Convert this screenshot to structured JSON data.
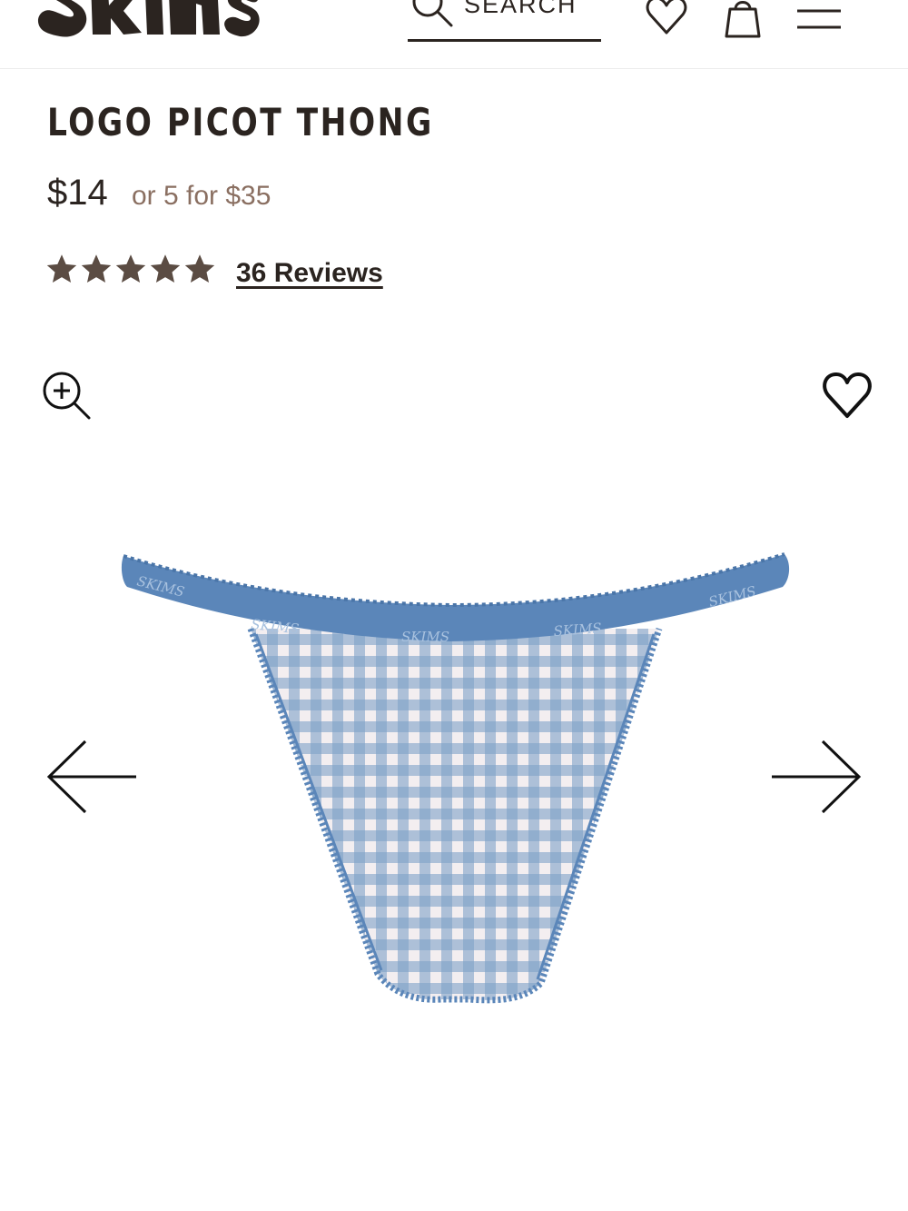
{
  "header": {
    "logo_text": "SKIMS",
    "search_label": "SEARCH",
    "icons": [
      "search-icon",
      "heart-icon",
      "bag-icon",
      "menu-icon"
    ]
  },
  "product": {
    "title": "LOGO PICOT THONG",
    "price": "$14",
    "bundle_offer": "or 5 for $35",
    "rating": 5,
    "rating_max": 5,
    "reviews_label": "36 Reviews",
    "waistband_text": "SKIMS"
  },
  "gallery": {
    "controls": [
      "zoom-in-icon",
      "wishlist-heart-icon",
      "arrow-left-icon",
      "arrow-right-icon"
    ],
    "image_alt": "Logo Picot Thong in blue gingham"
  },
  "colors": {
    "text": "#2b2420",
    "accent_price": "#8a6f61",
    "star": "#5b4c43",
    "waistband_blue": "#5b86b9",
    "gingham_blue": "#7fa2c8"
  }
}
